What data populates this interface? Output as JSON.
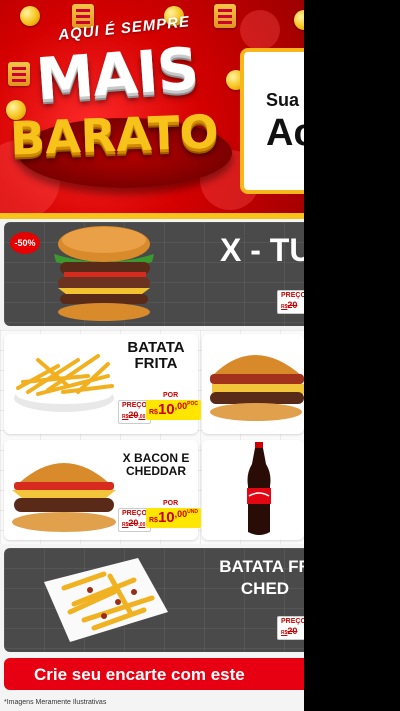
{
  "header": {
    "tagline": "AQUI É SEMPRE",
    "logo_line1": "MAIS",
    "logo_line2": "BARATO",
    "promo_sub": "Sua",
    "promo_main": "Ac"
  },
  "items": {
    "x_tudo": {
      "title": "X - TU",
      "discount": "-50%",
      "price_label": "PREÇO",
      "old_price": "20",
      "old_currency": "R$",
      "old_cents": ",00"
    },
    "batata_frita": {
      "title_line1": "BATATA",
      "title_line2": "FRITA",
      "price_label": "PREÇO",
      "old_price": "20",
      "old_currency": "R$",
      "old_cents": ",00",
      "por": "POR",
      "currency": "R$",
      "price": "10",
      "cents": ",00",
      "unit": "POC"
    },
    "x_bacon": {
      "title_line1": "X BACON E",
      "title_line2": "CHEDDAR",
      "price_label": "PREÇO",
      "old_price": "20",
      "old_currency": "R$",
      "old_cents": ",00",
      "por": "POR",
      "currency": "R$",
      "price": "10",
      "cents": ",00",
      "unit": "UND"
    },
    "batata_cheddar": {
      "title_line1": "BATATA FR",
      "title_line2": "CHED",
      "price_label": "PREÇO",
      "old_price": "20",
      "old_currency": "R$"
    }
  },
  "cta": {
    "label": "Crie seu encarte com este"
  },
  "footer": {
    "disclaimer": "*Imagens Meramente Ilustrativas"
  },
  "colors": {
    "brand_red": "#e60012",
    "yellow": "#f7c31a",
    "price_yellow": "#ffe600",
    "dark_block": "#4a4a4a"
  }
}
